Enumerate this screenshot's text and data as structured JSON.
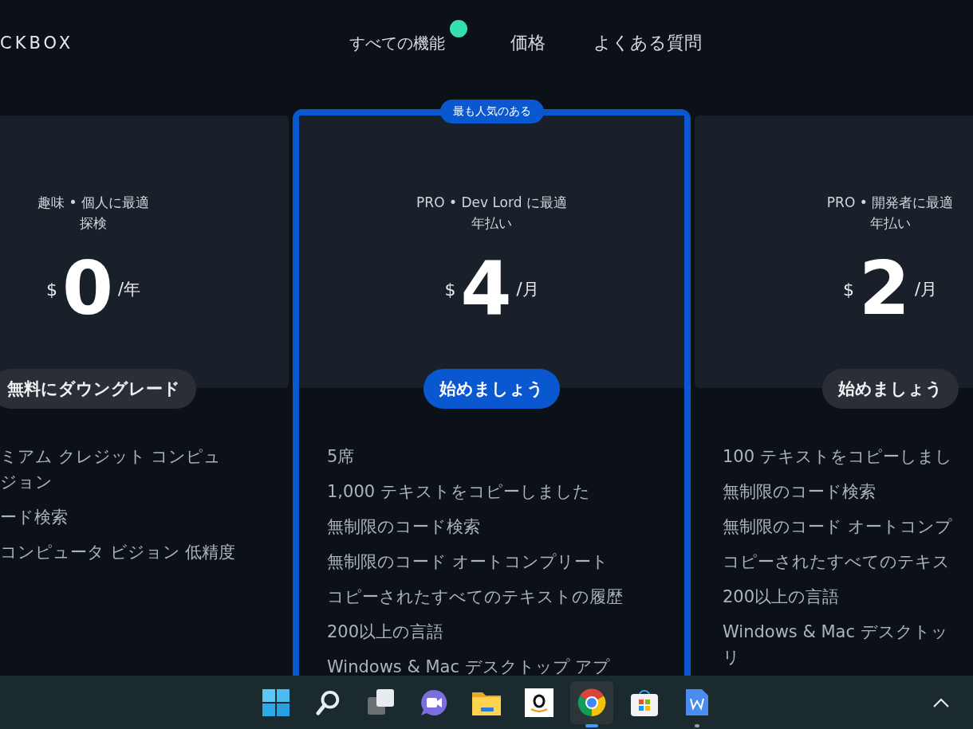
{
  "header": {
    "logo": "CKBOX",
    "nav": [
      {
        "label": "すべての機能",
        "dot": true
      },
      {
        "label": "価格",
        "dot": false
      },
      {
        "label": "よくある質問",
        "dot": false
      }
    ]
  },
  "plans": [
    {
      "highlighted": false,
      "subtitle": "趣味 • 個人に最適",
      "billing": "探検",
      "currency": "$",
      "price": "0",
      "period": "/年",
      "button": "無料にダウングレード",
      "features": [
        "ミアム クレジット コンピュジョン",
        "ード検索",
        "コンピュータ ビジョン 低精度"
      ]
    },
    {
      "highlighted": true,
      "badge": "最も人気のある",
      "subtitle": "PRO • Dev Lord に最適",
      "billing": "年払い",
      "currency": "$",
      "price": "4",
      "period": "/月",
      "button": "始めましょう",
      "features": [
        "5席",
        "1,000 テキストをコピーしました",
        "無制限のコード検索",
        "無制限のコード オートコンプリート",
        "コピーされたすべてのテキストの履歴",
        "200以上の言語",
        "Windows & Mac デスクトップ アプ"
      ]
    },
    {
      "highlighted": false,
      "subtitle": "PRO • 開発者に最適",
      "billing": "年払い",
      "currency": "$",
      "price": "2",
      "period": "/月",
      "button": "始めましょう",
      "features": [
        "100 テキストをコピーしまし",
        "無制限のコード検索",
        "無制限のコード オートコンプ",
        "コピーされたすべてのテキス",
        "200以上の言語",
        "Windows & Mac デスクトッリ"
      ]
    }
  ],
  "taskbar": {
    "apps": [
      {
        "kind": "start",
        "active": false,
        "running": false
      },
      {
        "kind": "search",
        "active": false,
        "running": false
      },
      {
        "kind": "taskview",
        "active": false,
        "running": false
      },
      {
        "kind": "chat",
        "active": false,
        "running": false
      },
      {
        "kind": "folder",
        "active": false,
        "running": false
      },
      {
        "kind": "shop",
        "active": false,
        "running": false
      },
      {
        "kind": "browser",
        "active": true,
        "running": true
      },
      {
        "kind": "store",
        "active": false,
        "running": false
      },
      {
        "kind": "doc",
        "active": false,
        "running": true
      }
    ]
  }
}
